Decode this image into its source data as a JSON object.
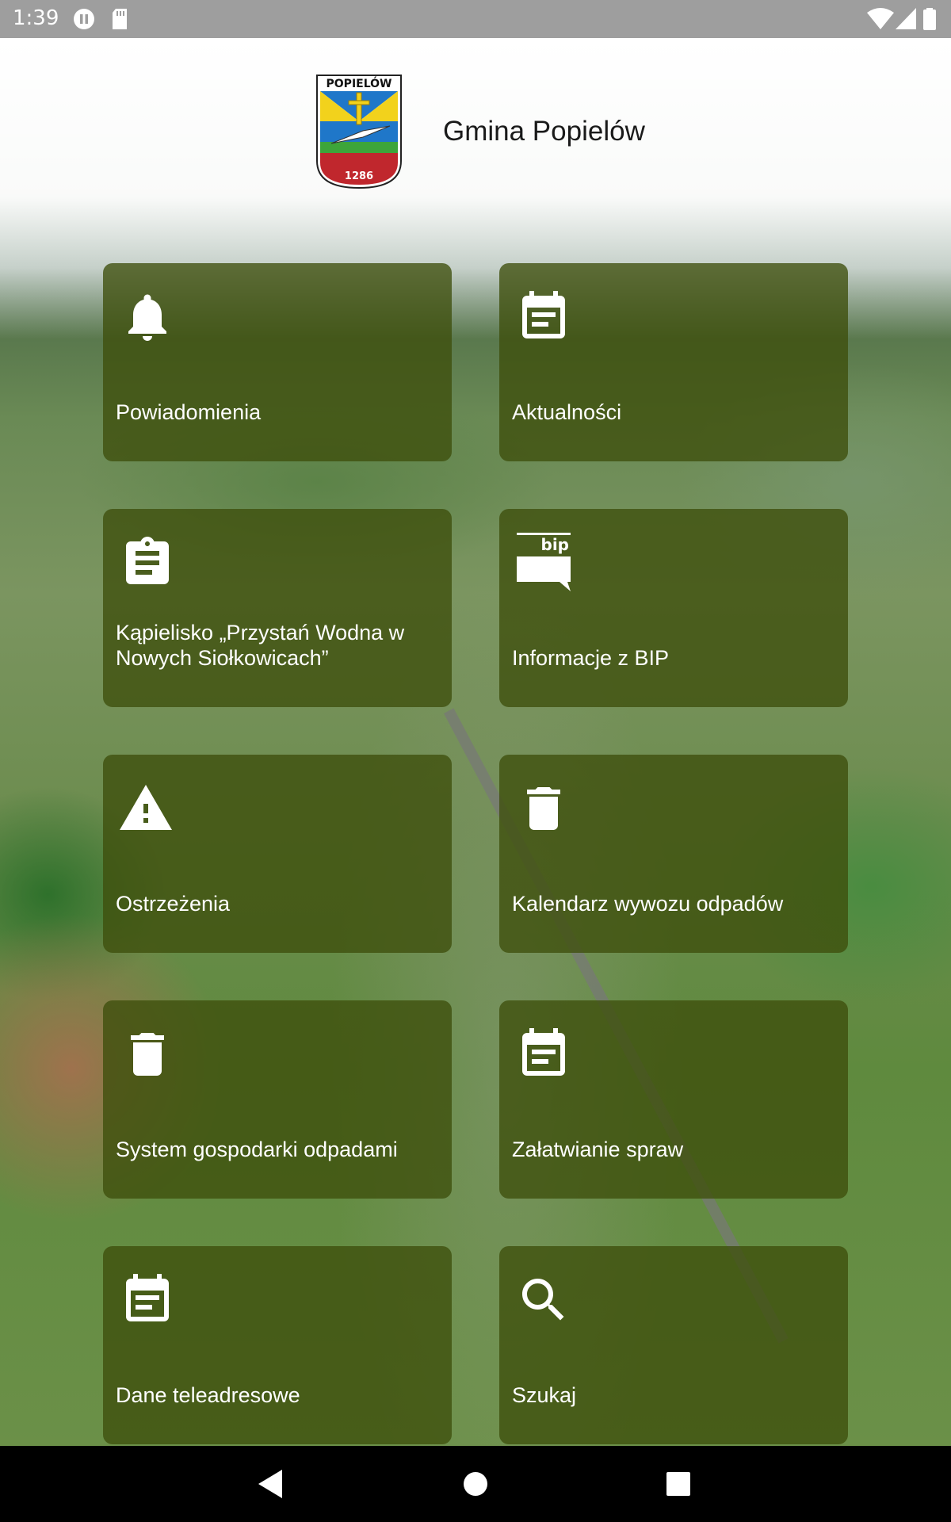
{
  "status_bar": {
    "time": "1:39",
    "icons": [
      "pause-circle-icon",
      "sd-card-icon",
      "wifi-icon",
      "signal-icon",
      "battery-icon"
    ]
  },
  "header": {
    "logo_icon": "coat-of-arms-logo",
    "logo_top_text": "POPIELÓW",
    "logo_year": "1286",
    "title": "Gmina Popielów"
  },
  "tiles": [
    {
      "label": "Powiadomienia",
      "icon": "bell-icon"
    },
    {
      "label": "Aktualności",
      "icon": "calendar-note-icon"
    },
    {
      "label": "Kąpielisko „Przystań Wodna w Nowych Siołkowicach”",
      "icon": "clipboard-icon"
    },
    {
      "label": "Informacje z BIP",
      "icon": "bip-icon",
      "icon_text": "bip"
    },
    {
      "label": "Ostrzeżenia",
      "icon": "warning-icon"
    },
    {
      "label": "Kalendarz wywozu odpadów",
      "icon": "trash-icon"
    },
    {
      "label": "System gospodarki odpadami",
      "icon": "trash-icon"
    },
    {
      "label": "Załatwianie spraw",
      "icon": "calendar-note-icon"
    },
    {
      "label": "Dane teleadresowe",
      "icon": "calendar-note-icon"
    },
    {
      "label": "Szukaj",
      "icon": "search-icon"
    }
  ],
  "nav_bar": {
    "buttons": [
      "back-icon",
      "home-icon",
      "recents-icon"
    ]
  },
  "colors": {
    "tile_background": "#3e4e0c",
    "status_bar": "#9e9e9e",
    "nav_bar": "#000000"
  }
}
